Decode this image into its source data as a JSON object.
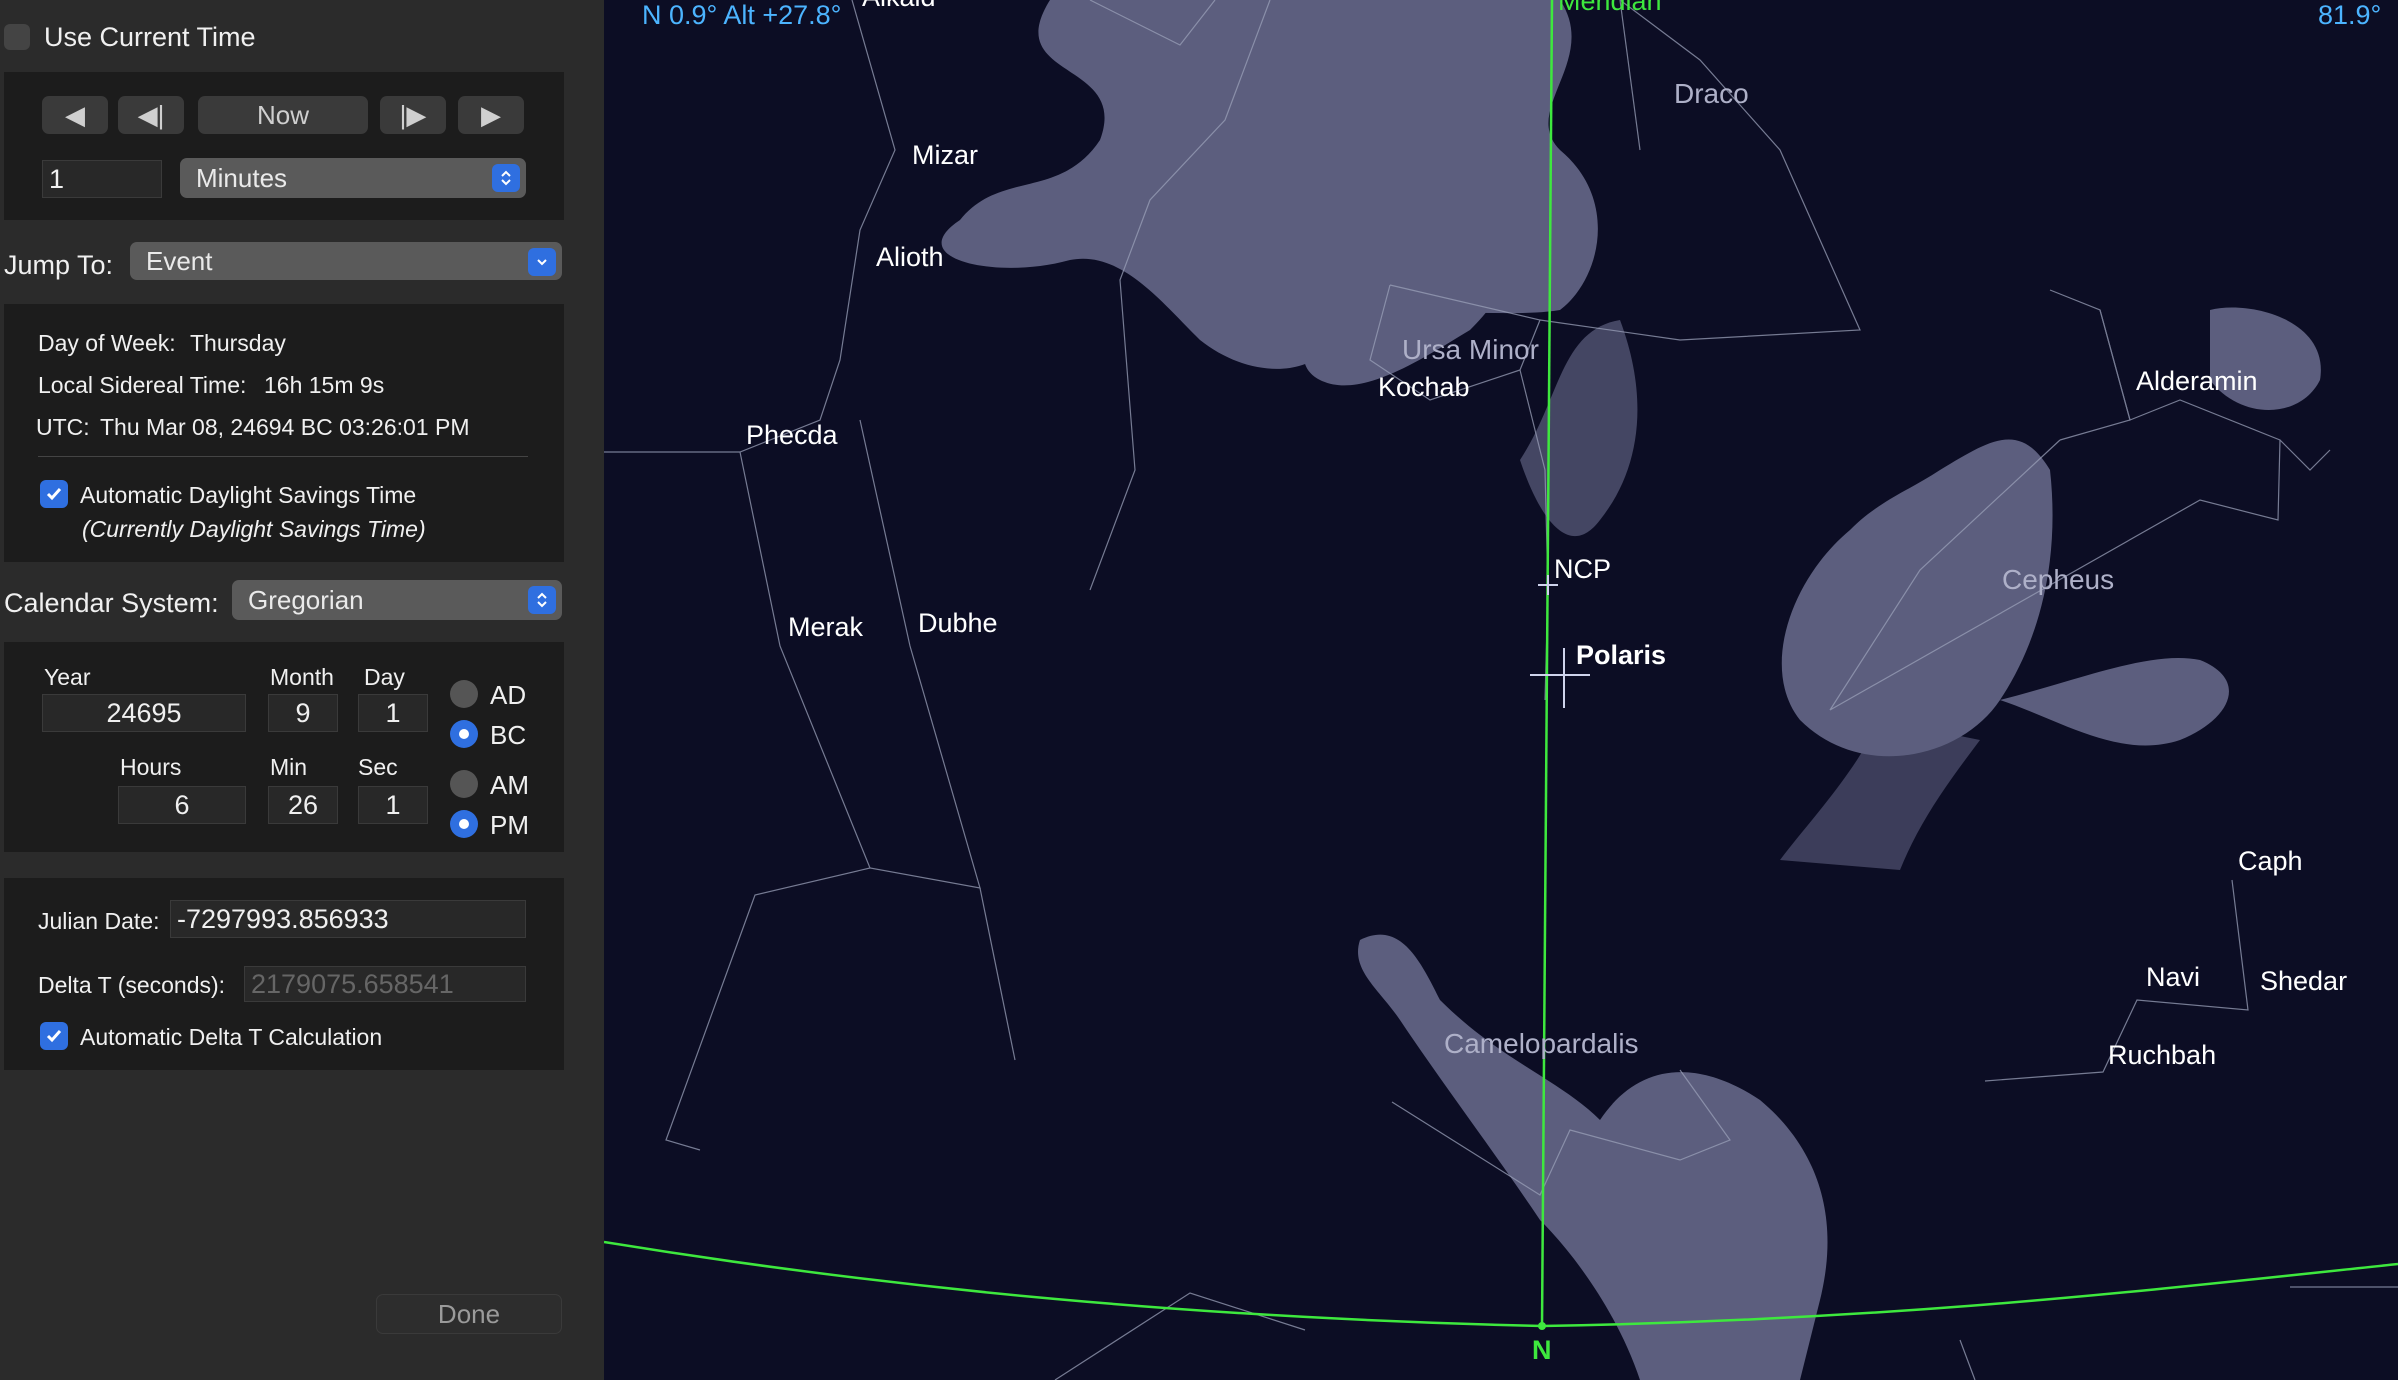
{
  "panel": {
    "use_current_time": "Use Current Time",
    "nav": {
      "back_fast": "◀",
      "back_step": "◀|",
      "now": "Now",
      "fwd_step": "|▶",
      "fwd_fast": "▶"
    },
    "step_value": "1",
    "step_unit": "Minutes",
    "jump_label": "Jump To:",
    "jump_value": "Event",
    "info": {
      "dow_label": "Day of Week:",
      "dow_value": "Thursday",
      "lst_label": "Local Sidereal Time:",
      "lst_value": "16h 15m 9s",
      "utc_label": "UTC:",
      "utc_value": "Thu Mar 08, 24694 BC 03:26:01 PM",
      "dst_label": "Automatic Daylight Savings Time",
      "dst_note": "(Currently Daylight Savings Time)"
    },
    "calendar_label": "Calendar System:",
    "calendar_value": "Gregorian",
    "date": {
      "year_label": "Year",
      "month_label": "Month",
      "day_label": "Day",
      "year": "24695",
      "month": "9",
      "day": "1",
      "hours_label": "Hours",
      "min_label": "Min",
      "sec_label": "Sec",
      "hours": "6",
      "min": "26",
      "sec": "1",
      "ad": "AD",
      "bc": "BC",
      "am": "AM",
      "pm": "PM",
      "era_selected": "BC",
      "meridiem_selected": "PM"
    },
    "julian_label": "Julian Date:",
    "julian_value": "-7297993.856933",
    "deltat_label": "Delta T (seconds):",
    "deltat_value": "2179075.658541",
    "auto_deltat_label": "Automatic Delta T Calculation",
    "done": "Done"
  },
  "sky": {
    "hud_left": "N 0.9° Alt +27.8°",
    "hud_right": "81.9°",
    "meridian": "Meridian",
    "alkaid_partial": "Alkaid",
    "north": "N",
    "stars": {
      "mizar": "Mizar",
      "alioth": "Alioth",
      "phecda": "Phecda",
      "merak": "Merak",
      "dubhe": "Dubhe",
      "kochab": "Kochab",
      "ncp": "NCP",
      "polaris": "Polaris",
      "alderamin": "Alderamin",
      "caph": "Caph",
      "navi": "Navi",
      "shedar": "Shedar",
      "ruchbah": "Ruchbah"
    },
    "constellations": {
      "draco": "Draco",
      "ursa_minor": "Ursa Minor",
      "cepheus": "Cepheus",
      "camelopardalis": "Camelopardalis"
    },
    "colors": {
      "hud": "#4cb4ff",
      "meridian": "#3ee83e",
      "sky": "#0c0d24"
    }
  }
}
